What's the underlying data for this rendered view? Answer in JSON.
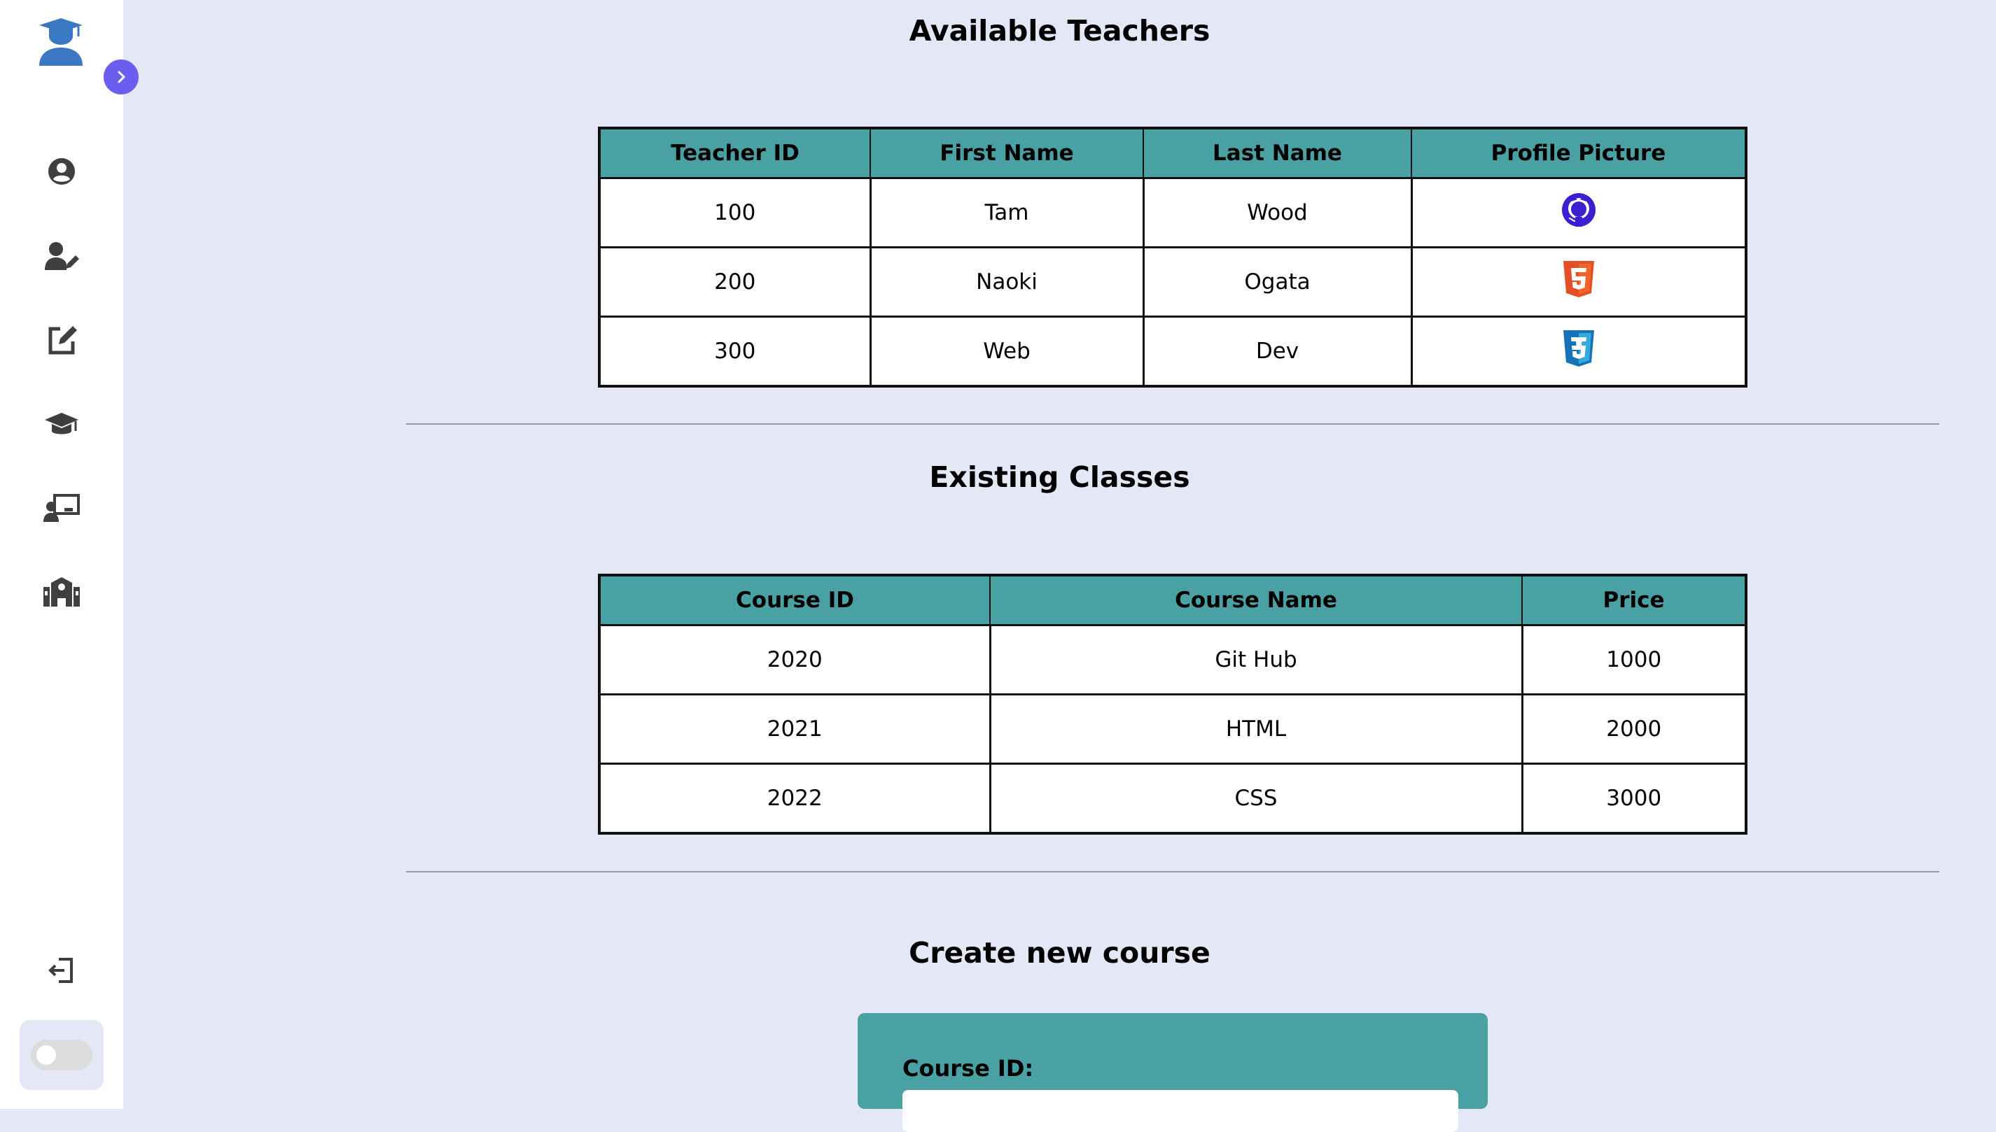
{
  "sidebar": {
    "logo_icon": "graduate-user-logo-icon",
    "toggle_icon": "chevron-right-icon",
    "nav_icons": [
      "user-circle-icon",
      "user-edit-icon",
      "edit-square-icon",
      "graduation-cap-icon",
      "teacher-board-icon",
      "school-icon"
    ],
    "logout_icon": "logout-icon",
    "theme_toggle": "off"
  },
  "teachers": {
    "title": "Available Teachers",
    "columns": [
      "Teacher ID",
      "First Name",
      "Last Name",
      "Profile Picture"
    ],
    "rows": [
      {
        "id": "100",
        "first": "Tam",
        "last": "Wood",
        "picture": "github-icon"
      },
      {
        "id": "200",
        "first": "Naoki",
        "last": "Ogata",
        "picture": "html5-icon"
      },
      {
        "id": "300",
        "first": "Web",
        "last": "Dev",
        "picture": "css3-icon"
      }
    ]
  },
  "classes": {
    "title": "Existing Classes",
    "columns": [
      "Course ID",
      "Course Name",
      "Price"
    ],
    "rows": [
      {
        "id": "2020",
        "name": "Git Hub",
        "price": "1000"
      },
      {
        "id": "2021",
        "name": "HTML",
        "price": "2000"
      },
      {
        "id": "2022",
        "name": "CSS",
        "price": "3000"
      }
    ]
  },
  "create": {
    "title": "Create new course",
    "course_id_label": "Course ID:",
    "course_id_value": ""
  },
  "colors": {
    "background": "#e4e7f6",
    "table_header": "#4aa1a3",
    "accent": "#6a5ef0",
    "icon": "#3f3f3f",
    "logo_blue": "#3a78c4"
  }
}
